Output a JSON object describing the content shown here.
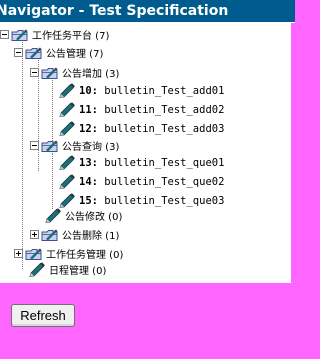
{
  "header": {
    "title": "Navigator - Test Specification"
  },
  "tree": {
    "root": {
      "label": "工作任务平台 (7)"
    },
    "announce_mgmt": {
      "label": "公告管理 (7)"
    },
    "announce_add": {
      "label": "公告增加 (3)"
    },
    "tc10": {
      "id": "10:",
      "name": "bulletin_Test_add01"
    },
    "tc11": {
      "id": "11:",
      "name": "bulletin_Test_add02"
    },
    "tc12": {
      "id": "12:",
      "name": "bulletin_Test_add03"
    },
    "announce_query": {
      "label": "公告查询 (3)"
    },
    "tc13": {
      "id": "13:",
      "name": "bulletin_Test_que01"
    },
    "tc14": {
      "id": "14:",
      "name": "bulletin_Test_que02"
    },
    "tc15": {
      "id": "15:",
      "name": "bulletin_Test_que03"
    },
    "announce_edit": {
      "label": "公告修改 (0)"
    },
    "announce_delete": {
      "label": "公告删除 (1)"
    },
    "task_mgmt": {
      "label": "工作任务管理 (0)"
    },
    "schedule_mgmt": {
      "label": "日程管理 (0)"
    }
  },
  "actions": {
    "refresh_label": "Refresh"
  },
  "colors": {
    "title_bg": "#005c8f",
    "page_bg": "#ff66ff",
    "folder": "#6a7fc0",
    "pen": "#1e6e7a"
  }
}
